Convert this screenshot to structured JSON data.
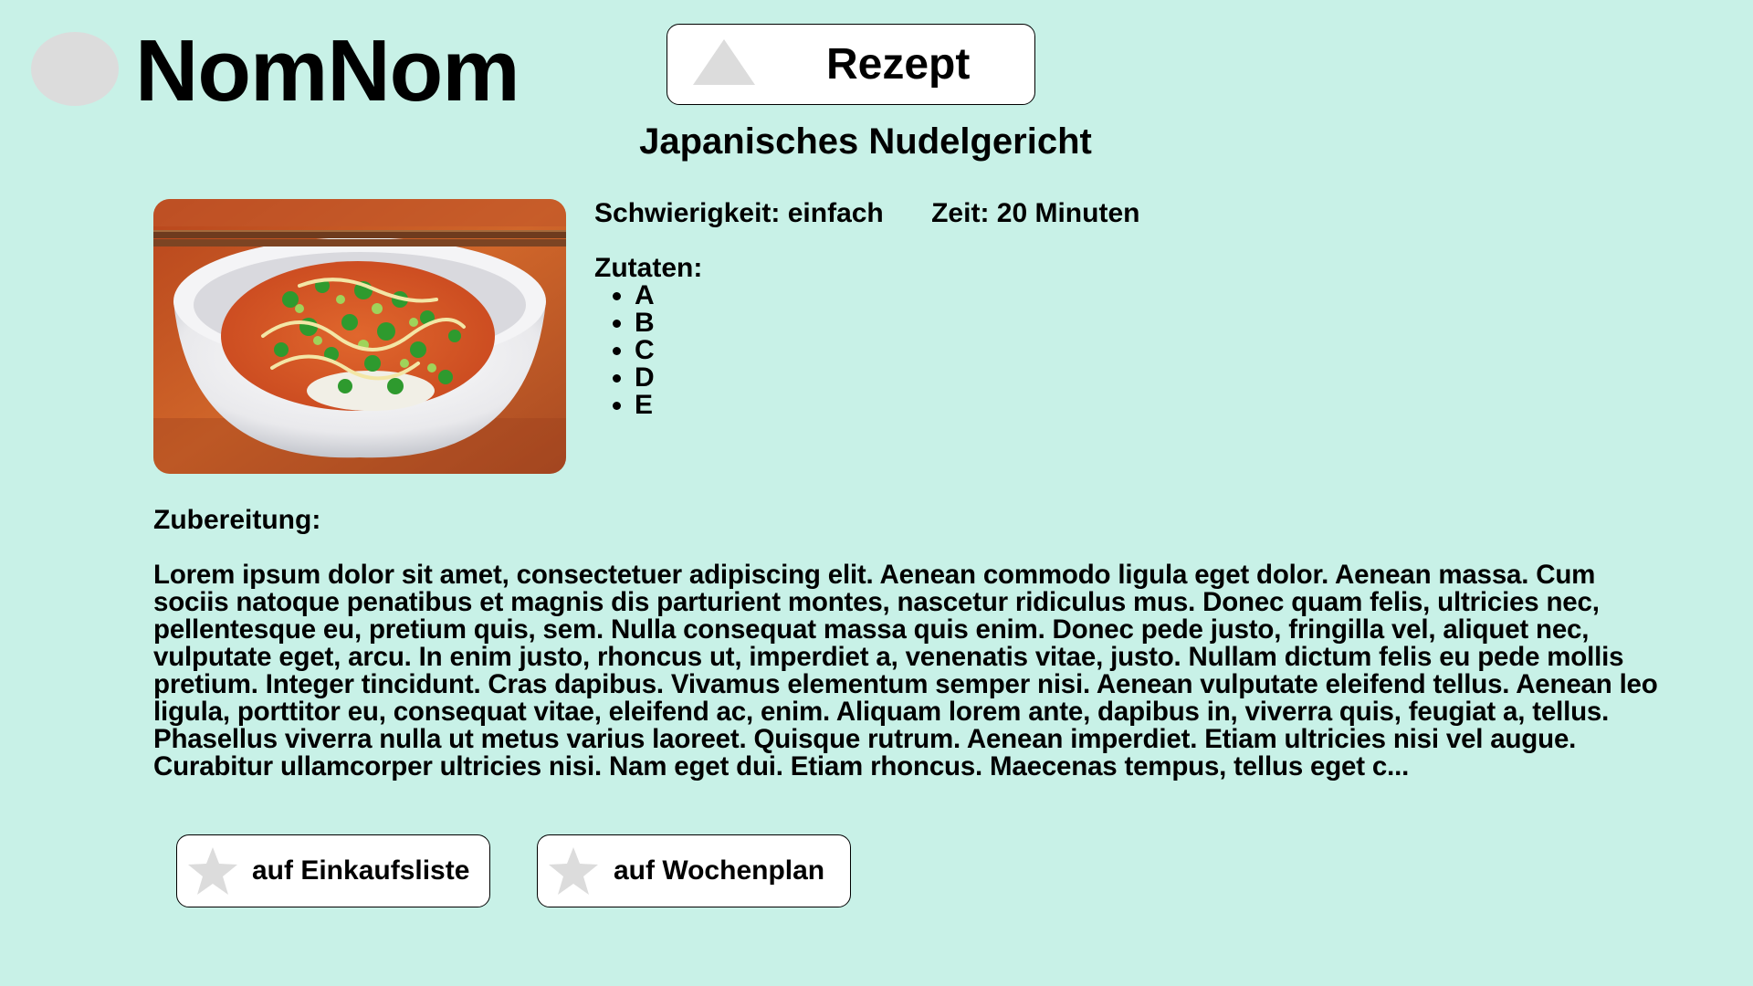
{
  "header": {
    "logo_icon": "circle-logo-icon",
    "app_title": "NomNom",
    "mode_button": {
      "icon": "triangle-icon",
      "label": "Rezept"
    }
  },
  "recipe": {
    "title": "Japanisches Nudelgericht",
    "image": "photo of a japanese noodle bowl with chopsticks",
    "difficulty": "Schwierigkeit: einfach",
    "time": "Zeit: 20 Minuten",
    "ingredients_label": "Zutaten:",
    "ingredients": [
      "A",
      "B",
      "C",
      "D",
      "E"
    ],
    "preparation_label": "Zubereitung:",
    "preparation_text": "Lorem ipsum dolor sit amet, consectetuer adipiscing elit. Aenean commodo ligula eget dolor. Aenean massa. Cum sociis natoque penatibus et magnis dis parturient montes, nascetur ridiculus mus. Donec quam felis, ultricies nec, pellentesque eu, pretium quis, sem. Nulla consequat massa quis enim. Donec pede justo, fringilla vel, aliquet nec, vulputate eget, arcu. In enim justo, rhoncus ut, imperdiet a, venenatis vitae, justo. Nullam dictum felis eu pede mollis pretium. Integer tincidunt. Cras dapibus. Vivamus elementum semper nisi. Aenean vulputate eleifend tellus. Aenean leo ligula, porttitor eu, consequat vitae, eleifend ac, enim. Aliquam lorem ante, dapibus in, viverra quis, feugiat a, tellus. Phasellus viverra nulla ut metus varius laoreet. Quisque rutrum. Aenean imperdiet. Etiam ultricies nisi vel augue. Curabitur ullamcorper ultricies nisi. Nam eget dui. Etiam rhoncus. Maecenas tempus, tellus eget c..."
  },
  "actions": {
    "shopping_list": {
      "icon": "star-icon",
      "label": "auf Einkaufsliste"
    },
    "weekly_plan": {
      "icon": "star-icon",
      "label": "auf Wochenplan"
    }
  },
  "colors": {
    "background": "#c8f1e7",
    "button_background": "#ffffff",
    "placeholder_gray": "#dcdcdc"
  }
}
